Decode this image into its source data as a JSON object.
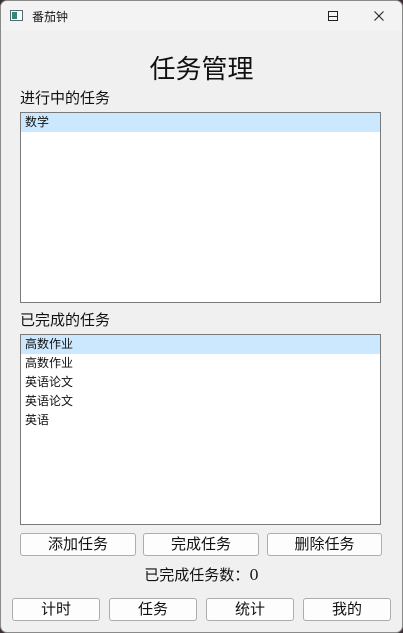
{
  "window": {
    "title": "番茄钟",
    "minimize_icon": "minimize-icon",
    "maximize_icon": "maximize-icon",
    "close_icon": "close-icon"
  },
  "main": {
    "title": "任务管理",
    "in_progress": {
      "label": "进行中的任务",
      "items": [
        {
          "text": "数学",
          "selected": true
        }
      ]
    },
    "completed": {
      "label": "已完成的任务",
      "items": [
        {
          "text": "高数作业",
          "selected": true
        },
        {
          "text": "高数作业",
          "selected": false
        },
        {
          "text": "英语论文",
          "selected": false
        },
        {
          "text": "英语论文",
          "selected": false
        },
        {
          "text": "英语",
          "selected": false
        }
      ]
    },
    "actions": {
      "add": "添加任务",
      "complete": "完成任务",
      "delete": "删除任务"
    },
    "completed_count": {
      "label": "已完成任务数：",
      "value": "0"
    }
  },
  "nav": {
    "timer": "计时",
    "tasks": "任务",
    "stats": "统计",
    "mine": "我的"
  },
  "colors": {
    "selection": "#cce8ff",
    "window_bg": "#f0f0f0"
  }
}
